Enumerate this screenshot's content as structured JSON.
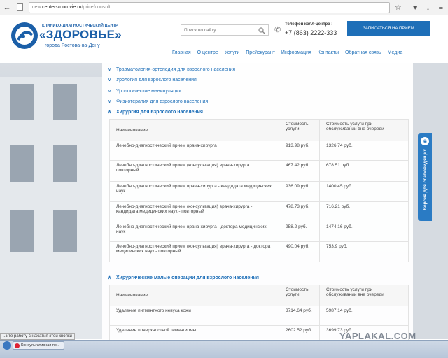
{
  "browser": {
    "url_prefix": "new.",
    "url_host": "center-zdorovie.ru",
    "url_path": "/price/consult"
  },
  "site": {
    "logo_small": "КЛИНИКО-ДИАГНОСТИЧЕСКИЙ ЦЕНТР",
    "logo_big": "«ЗДОРОВЬЕ»",
    "logo_city": "города Ростова-на-Дону",
    "search_placeholder": "Поиск по сайту...",
    "phone_label": "Телефон колл-центра :",
    "phone_number": "+7 (863) 2222-333",
    "cta_label": "ЗАПИСАТЬСЯ НА ПРИЕМ",
    "nav": [
      "Главная",
      "О центре",
      "Услуги",
      "Прейскурант",
      "Информация",
      "Контакты",
      "Обратная связь",
      "Медиа"
    ],
    "side_tab_label": "Версия для слабовидящих"
  },
  "accordion": [
    {
      "label": "Травматология-ортопедия для взрослого населения",
      "open": false
    },
    {
      "label": "Урология для взрослого населения",
      "open": false
    },
    {
      "label": "Урологические манипуляции",
      "open": false
    },
    {
      "label": "Физиотерапия для взрослого населения",
      "open": false
    },
    {
      "label": "Хирургия для взрослого населения",
      "open": true
    }
  ],
  "table1": {
    "headers": [
      "Наименование",
      "Стоимость услуги",
      "Стоимость услуги при обслуживании вне очереди"
    ],
    "rows": [
      [
        "Лечебно-диагностический прием врача-хирурга",
        "913.98 руб.",
        "1326.74 руб."
      ],
      [
        "Лечебно-диагностический прием (консультация) врача-хирурга повторный",
        "467.42 руб.",
        "678.51 руб."
      ],
      [
        "Лечебно-диагностический прием врача-хирурга - кандидата медицинских наук",
        "936.09 руб.",
        "1400.45 руб."
      ],
      [
        "Лечебно-диагностический прием (консультация) врача-хирурга - кандидата медицинских наук - повторный",
        "478.73 руб.",
        "716.21 руб."
      ],
      [
        "Лечебно-диагностический прием врача-хирурга - доктора медицинских наук",
        "958.2 руб.",
        "1474.16 руб."
      ],
      [
        "Лечебно-диагностический прием (консультация) врача-хирурга - доктора медицинских наук - повторный",
        "490.04 руб.",
        "753.9 руб."
      ]
    ]
  },
  "section2": {
    "label": "Хирургические малые операции для взрослого населения"
  },
  "table2": {
    "headers": [
      "Наименование",
      "Стоимость услуги",
      "Стоимость услуги при обслуживании вне очереди"
    ],
    "rows": [
      [
        "Удаление пигментного невуса кожи",
        "3714.64 руб.",
        "5987.14 руб."
      ],
      [
        "Удаление поверхностной гемангиомы",
        "2602.52 руб.",
        "3699.73 руб."
      ]
    ]
  },
  "status": {
    "text": "...ите работу с нажатия этой кнопки"
  },
  "taskbar": {
    "item_label": "Консультативная по..."
  },
  "watermark": "YAPLAKAL.COM",
  "colors": {
    "brand": "#1e6fb8",
    "cta": "#1e6fb8",
    "side_tab": "#2a7bc4"
  }
}
